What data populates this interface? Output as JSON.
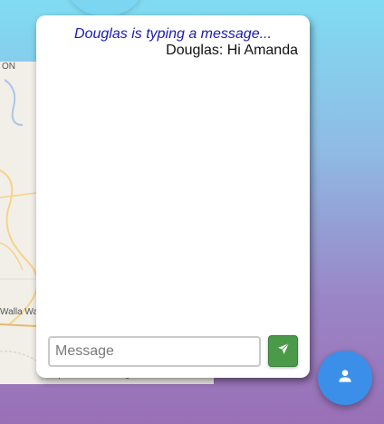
{
  "map": {
    "labels": [
      "ON",
      "Walla Walla"
    ],
    "attribution": "Map data ©2020 Google   Terms of Use"
  },
  "chat": {
    "typing_indicator": "Douglas is typing a message...",
    "messages": [
      {
        "text": "Douglas: Hi Amanda"
      }
    ],
    "input": {
      "placeholder": "Message",
      "value": ""
    },
    "send_icon": "paper-plane-icon"
  },
  "fab": {
    "icon": "person-icon"
  },
  "colors": {
    "typing": "#1a1ab8",
    "send_button": "#4a9a4a",
    "fab": "#3b8fe8"
  }
}
